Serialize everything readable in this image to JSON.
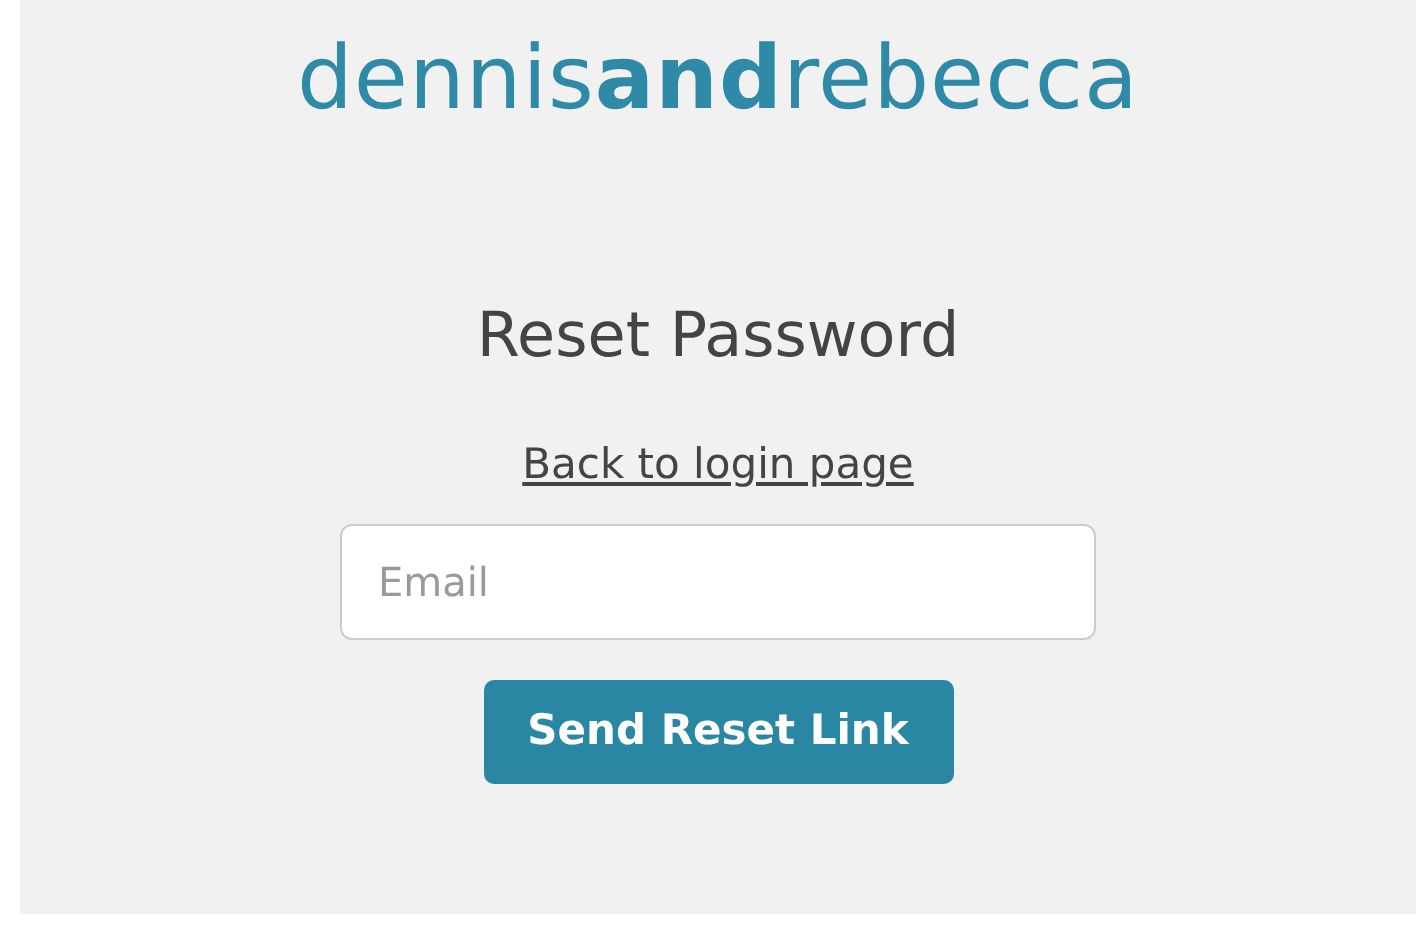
{
  "logo": "dennis**and**rebecca",
  "heading": "Reset Password",
  "back_link": "Back to login page",
  "email_field": {
    "placeholder": "Email"
  },
  "submit_button": "Send Reset Link"
}
